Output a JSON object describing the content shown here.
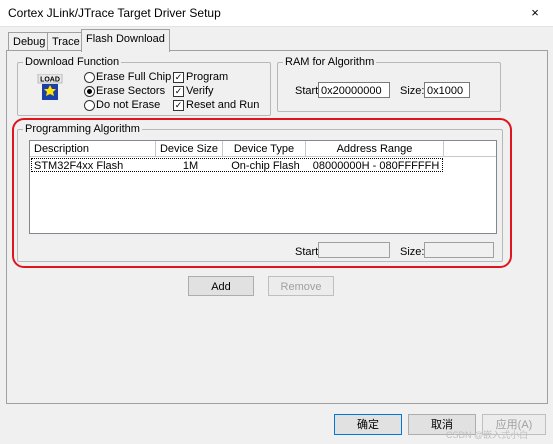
{
  "window": {
    "title": "Cortex JLink/JTrace Target Driver Setup",
    "close": "×"
  },
  "tabs": [
    "Debug",
    "Trace",
    "Flash Download"
  ],
  "download_function": {
    "title": "Download Function",
    "icon": "load-icon",
    "icon_text": "LOAD",
    "erase_options": [
      "Erase Full Chip",
      "Erase Sectors",
      "Do not Erase"
    ],
    "selected_erase": "Erase Sectors",
    "checks": [
      {
        "label": "Program",
        "checked": true
      },
      {
        "label": "Verify",
        "checked": true
      },
      {
        "label": "Reset and Run",
        "checked": true
      }
    ]
  },
  "ram": {
    "title": "RAM for Algorithm",
    "start_label": "Start:",
    "start_value": "0x20000000",
    "size_label": "Size:",
    "size_value": "0x1000"
  },
  "programming_algorithm": {
    "title": "Programming Algorithm",
    "columns": [
      "Description",
      "Device Size",
      "Device Type",
      "Address Range"
    ],
    "rows": [
      [
        "STM32F4xx Flash",
        "1M",
        "On-chip Flash",
        "08000000H - 080FFFFFH"
      ]
    ],
    "start_label": "Start:",
    "start_value": "",
    "size_label": "Size:",
    "size_value": ""
  },
  "buttons": {
    "add": "Add",
    "remove": "Remove"
  },
  "footer": {
    "ok": "确定",
    "cancel": "取消",
    "apply": "应用(A)"
  },
  "watermark": "CSDN @嵌入式小白",
  "colors": {
    "highlight_box": "#e0141e",
    "accent": "#0078d7"
  }
}
